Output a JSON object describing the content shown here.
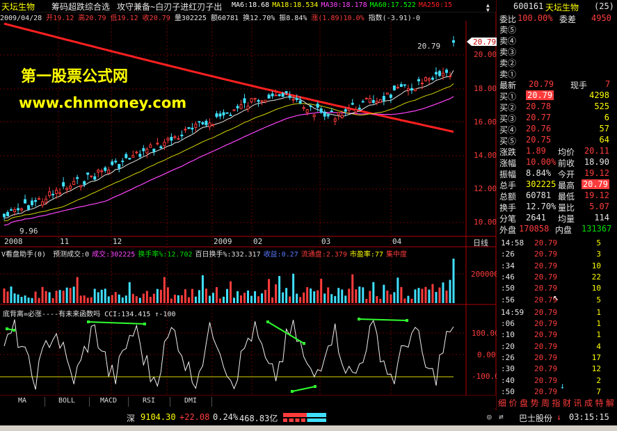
{
  "header": {
    "stock_name": "天坛生物",
    "formula_title": "筹码超跌综合选",
    "formula_desc": "攻守兼备~白刃子进红刃子出",
    "ma_legend": [
      {
        "label": "MA6:18.68",
        "color": "#ffffff"
      },
      {
        "label": "MA18:18.534",
        "color": "#ffff00"
      },
      {
        "label": "MA30:18.178",
        "color": "#ff44ff"
      },
      {
        "label": "MA60:17.522",
        "color": "#00ff00"
      },
      {
        "label": "MA250:15",
        "color": "#ff2020"
      }
    ],
    "scroll_up": "▲",
    "scroll_down": "▼"
  },
  "ohlc_line": {
    "date": "2009/04/28",
    "open": "开19.12",
    "high": "高20.79",
    "low": "低19.12",
    "close": "收20.79",
    "volume": "量302225",
    "amount": "额60781",
    "turnover": "换12.70%",
    "amplitude": "振8.84%",
    "rise": "涨(1.89)10.0%",
    "index": "指数(-3.91)-0"
  },
  "watermark": {
    "title": "第一股票公式网",
    "url": "www.chnmoney.com"
  },
  "price_axis": {
    "labels": [
      "20.00",
      "18.00",
      "16.00",
      "14.00",
      "12.00",
      "10.00"
    ],
    "current_price_tag": "20.79",
    "high_label": "20.79",
    "low_label": "9.96"
  },
  "date_axis": [
    "2008",
    "11",
    "12",
    "2009",
    "02",
    "03",
    "04"
  ],
  "date_axis_unit": "日线",
  "volume_panel": {
    "title": "V看盘助手(0)",
    "items": [
      {
        "label": "预测成交:0",
        "color": "#e0e0e0"
      },
      {
        "label": "成交:302225",
        "color": "#ff44ff"
      },
      {
        "label": "换手率%:12.702",
        "color": "#00e000"
      },
      {
        "label": "百日换手%:332.317",
        "color": "#e0e0e0"
      },
      {
        "label": "收益:0.27",
        "color": "#5a7bff"
      },
      {
        "label": "流通盘:2.379",
        "color": "#ff3c3c"
      },
      {
        "label": "市盈率:77",
        "color": "#ffff00"
      },
      {
        "label": "集中度",
        "color": "#ff3c3c"
      }
    ],
    "axis_label": "200000"
  },
  "cci_panel": {
    "title": "底背离=必涨----有未来函数吗",
    "value": "CCI:134.415",
    "ref": "↑-100",
    "axis": [
      "100.00",
      "0.00",
      "-100.00"
    ]
  },
  "bottom_tabs": [
    "MA",
    "BOLL",
    "MACD",
    "RSI",
    "DMI"
  ],
  "status_bar": {
    "index_name": "深",
    "index_value": "9104.30",
    "index_change": "+22.08",
    "index_pct": "0.24%",
    "index_amount": "468.83亿",
    "ticker_name": "巴士股份",
    "ticker_arrow": "↓",
    "time": "03:15:15"
  },
  "quote_panel": {
    "code": "600161",
    "name": "天坛生物",
    "num": "(25)",
    "weibi_label": "委比",
    "weibi_value": "100.00%",
    "weicha_label": "委差",
    "weicha_value": "4950",
    "asks": [
      {
        "label": "卖⑤",
        "price": "",
        "vol": ""
      },
      {
        "label": "卖④",
        "price": "",
        "vol": ""
      },
      {
        "label": "卖③",
        "price": "",
        "vol": ""
      },
      {
        "label": "卖②",
        "price": "",
        "vol": ""
      },
      {
        "label": "卖①",
        "price": "",
        "vol": ""
      }
    ],
    "last_label": "最新",
    "last_value": "20.79",
    "cur_vol_label": "现手",
    "cur_vol_value": "7",
    "bids": [
      {
        "label": "买①",
        "price": "20.79",
        "vol": "4298"
      },
      {
        "label": "买②",
        "price": "20.78",
        "vol": "525"
      },
      {
        "label": "买③",
        "price": "20.77",
        "vol": "6"
      },
      {
        "label": "买④",
        "price": "20.76",
        "vol": "57"
      },
      {
        "label": "买⑤",
        "price": "20.75",
        "vol": "64"
      }
    ],
    "stats": [
      {
        "l1": "涨跌",
        "v1": "1.89",
        "c1": "#ff3c3c",
        "l2": "均价",
        "v2": "20.11",
        "c2": "#ff3c3c"
      },
      {
        "l1": "涨幅",
        "v1": "10.00%",
        "c1": "#ff3c3c",
        "l2": "前收",
        "v2": "18.90",
        "c2": "#e6e6e6"
      },
      {
        "l1": "振幅",
        "v1": "8.84%",
        "c1": "#e6e6e6",
        "l2": "今开",
        "v2": "19.12",
        "c2": "#ff3c3c"
      },
      {
        "l1": "总手",
        "v1": "302225",
        "c1": "#ffff00",
        "l2": "最高",
        "v2": "20.79",
        "c2": "#ffffff"
      },
      {
        "l1": "总额",
        "v1": "60781",
        "c1": "#e6e6e6",
        "l2": "最低",
        "v2": "19.12",
        "c2": "#ff3c3c"
      },
      {
        "l1": "换手",
        "v1": "12.70%",
        "c1": "#e6e6e6",
        "l2": "量比",
        "v2": "5.07",
        "c2": "#ff3c3c"
      },
      {
        "l1": "分笔",
        "v1": "2641",
        "c1": "#e6e6e6",
        "l2": "均量",
        "v2": "114",
        "c2": "#e6e6e6"
      }
    ],
    "outer_label": "外盘",
    "outer_value": "170858",
    "inner_label": "内盘",
    "inner_value": "131367"
  },
  "ticks": [
    {
      "time": "14:58",
      "price": "20.79",
      "vol": "5"
    },
    {
      "time": ":26",
      "price": "20.79",
      "vol": "3"
    },
    {
      "time": ":34",
      "price": "20.79",
      "vol": "10"
    },
    {
      "time": ":46",
      "price": "20.79",
      "vol": "22"
    },
    {
      "time": ":50",
      "price": "20.79",
      "vol": "10"
    },
    {
      "time": ":56",
      "price": "20.79",
      "vol": "5"
    },
    {
      "time": "14:59",
      "price": "20.79",
      "vol": "1"
    },
    {
      "time": ":06",
      "price": "20.79",
      "vol": "1"
    },
    {
      "time": ":10",
      "price": "20.79",
      "vol": "1"
    },
    {
      "time": ":20",
      "price": "20.79",
      "vol": "4"
    },
    {
      "time": ":26",
      "price": "20.79",
      "vol": "17"
    },
    {
      "time": ":30",
      "price": "20.79",
      "vol": "12"
    },
    {
      "time": ":40",
      "price": "20.79",
      "vol": "2"
    },
    {
      "time": ":50",
      "price": "20.79",
      "vol": "7"
    }
  ],
  "ticks_tail_arrow": "↓",
  "right_tabs": [
    "细",
    "价",
    "盘",
    "势",
    "周",
    "指",
    "财",
    "讯",
    "成",
    "特",
    "解"
  ]
}
